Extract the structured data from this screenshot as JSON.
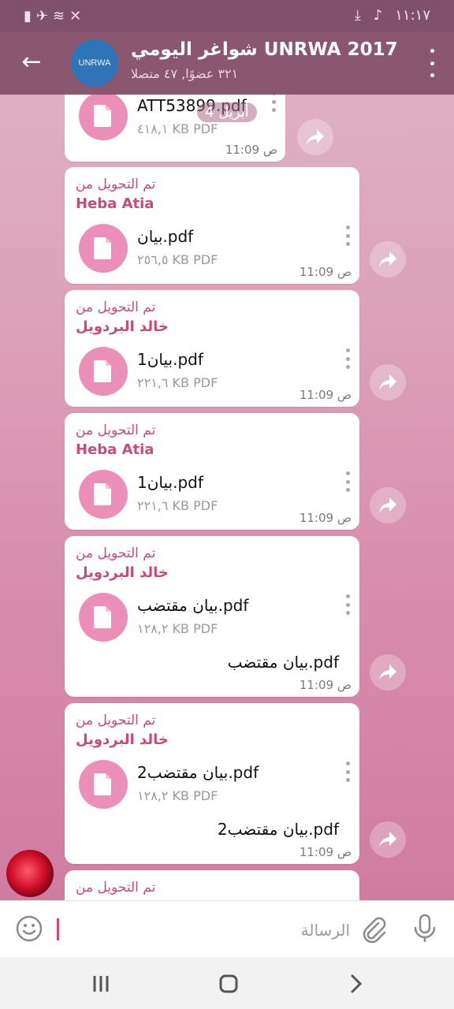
{
  "status_bar": {
    "left_icons": [
      "battery-icon",
      "airplane-icon",
      "wifi-icon",
      "mute-icon"
    ],
    "right_icons": [
      "download-icon",
      "music-icon"
    ],
    "time": "١١:١٧"
  },
  "header": {
    "title": "شواغر اليومي UNRWA 2017",
    "subtitle": "٣٢١ عضوًا, ٤٧ متصلا",
    "avatar_text": "UNRWA"
  },
  "date_pill": "4 أبريل",
  "messages": [
    {
      "forwarded_label": "",
      "forwarded_from": "",
      "file_name": "ATT53899.pdf",
      "file_size": "٤١٨,١ KB PDF",
      "caption": "",
      "time": "11:09",
      "period": "ص"
    },
    {
      "forwarded_label": "تم التحويل من",
      "forwarded_from": "Heba Atia",
      "file_name": "بيان.pdf",
      "file_size": "٢٥٦,٥ KB PDF",
      "caption": "",
      "time": "11:09",
      "period": "ص"
    },
    {
      "forwarded_label": "تم التحويل من",
      "forwarded_from": "خالد البردويل",
      "file_name": "بيان1.pdf",
      "file_size": "٢٢١,٦ KB PDF",
      "caption": "",
      "time": "11:09",
      "period": "ص"
    },
    {
      "forwarded_label": "تم التحويل من",
      "forwarded_from": "Heba Atia",
      "file_name": "بيان1.pdf",
      "file_size": "٢٢١,٦ KB PDF",
      "caption": "",
      "time": "11:09",
      "period": "ص"
    },
    {
      "forwarded_label": "تم التحويل من",
      "forwarded_from": "خالد البردويل",
      "file_name": "بيان مقتضب.pdf",
      "file_size": "١٢٨,٢ KB PDF",
      "caption": "بيان مقتضب.pdf",
      "time": "11:09",
      "period": "ص"
    },
    {
      "forwarded_label": "تم التحويل من",
      "forwarded_from": "خالد البردويل",
      "file_name": "بيان مقتضب2.pdf",
      "file_size": "١٢٨,٢ KB PDF",
      "caption": "بيان مقتضب2.pdf",
      "time": "11:09",
      "period": "ص"
    },
    {
      "forwarded_label": "تم التحويل من",
      "forwarded_from": "",
      "file_name": "",
      "file_size": "",
      "caption": "",
      "time": "",
      "period": ""
    }
  ],
  "input": {
    "placeholder": "الرسالة"
  },
  "colors": {
    "header": "#8a5670",
    "accent": "#c64a7e",
    "file_icon": "#ec8fb8"
  }
}
